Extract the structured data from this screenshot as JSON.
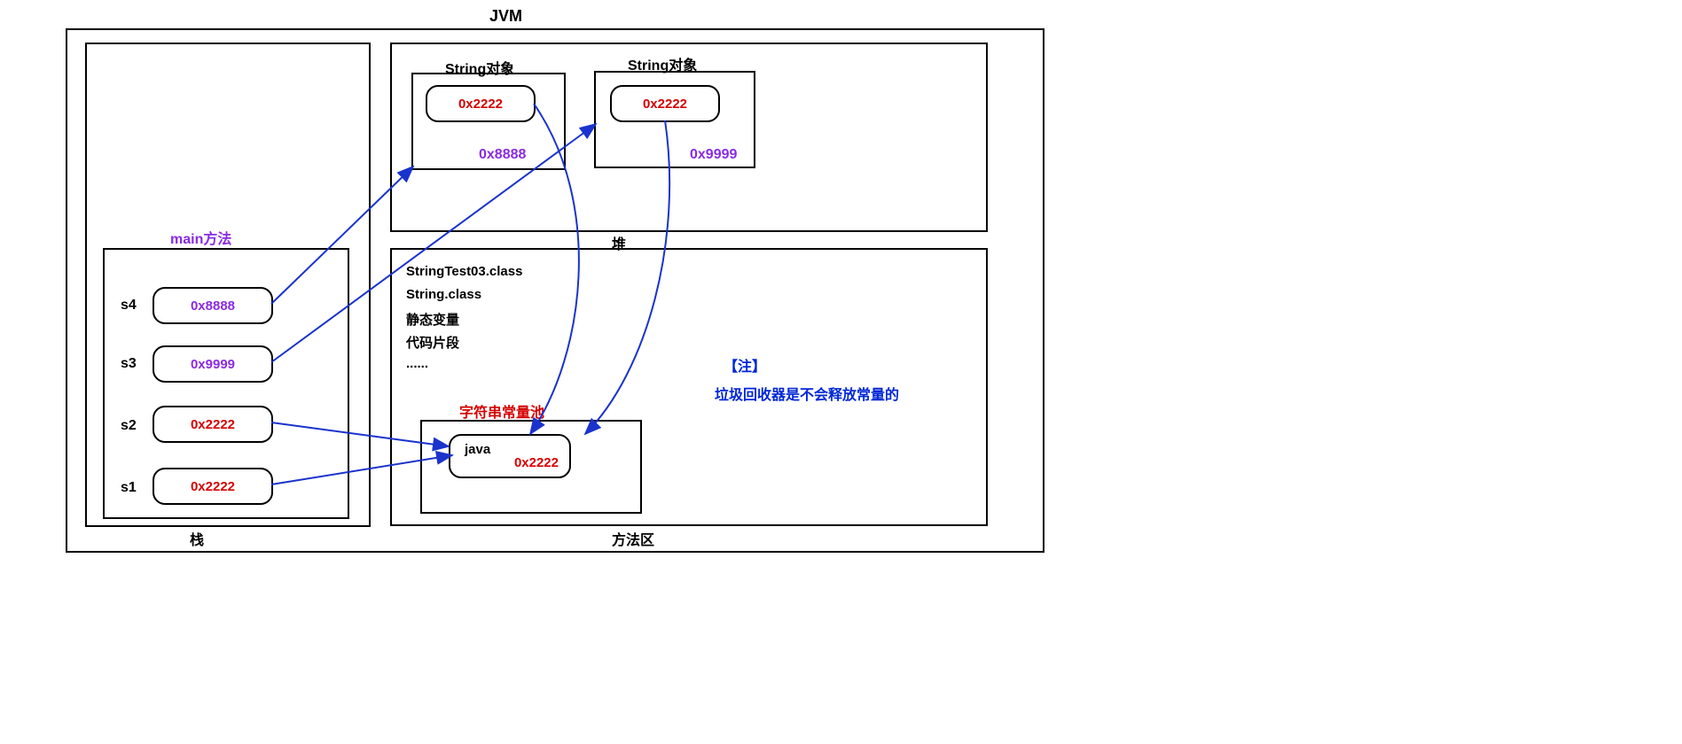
{
  "jvm": {
    "title": "JVM"
  },
  "stack": {
    "label": "栈",
    "main_label": "main方法",
    "vars": [
      {
        "name": "s4",
        "value": "0x8888",
        "cls": "purple"
      },
      {
        "name": "s3",
        "value": "0x9999",
        "cls": "purple"
      },
      {
        "name": "s2",
        "value": "0x2222",
        "cls": "red"
      },
      {
        "name": "s1",
        "value": "0x2222",
        "cls": "red"
      }
    ]
  },
  "heap": {
    "label": "堆",
    "obj1": {
      "title": "String对象",
      "value": "0x2222",
      "addr": "0x8888"
    },
    "obj2": {
      "title": "String对象",
      "value": "0x2222",
      "addr": "0x9999"
    }
  },
  "method_area": {
    "label": "方法区",
    "lines": {
      "l1": "StringTest03.class",
      "l2": "String.class",
      "l3": "静态变量",
      "l4": "代码片段",
      "l5": "......"
    },
    "pool": {
      "title": "字符串常量池",
      "entry_label": "java",
      "entry_addr": "0x2222"
    },
    "note": {
      "title": "【注】",
      "body": "垃圾回收器是不会释放常量的"
    }
  }
}
